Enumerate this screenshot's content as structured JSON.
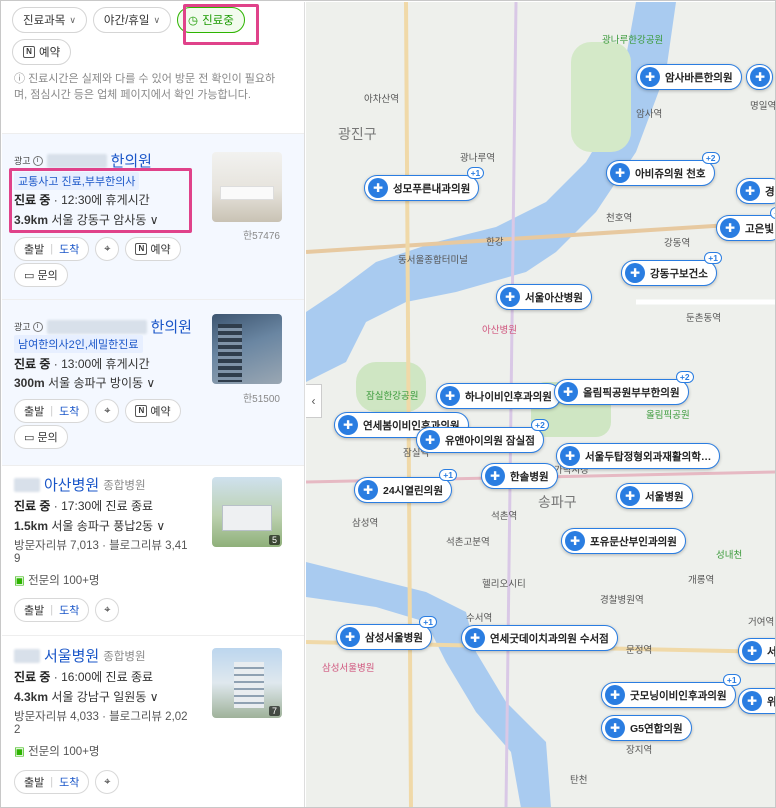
{
  "filters": {
    "subject": "진료과목",
    "night": "야간/휴일",
    "open": "진료중",
    "reserve": "예약"
  },
  "notice": "진료시간은 실제와 다를 수 있어 방문 전 확인이 필요하며, 점심시간 등은 업체 페이지에서 확인 가능합니다.",
  "cards": [
    {
      "ad": "광고",
      "name": "한의원",
      "promo": "교통사고 진료,부부한의사",
      "status_label": "진료 중",
      "status_rest": " · 12:30에 휴게시간",
      "distance": "3.9km",
      "address": "서울 강동구 암사동",
      "thumb_caption": "한57476",
      "btn_depart": "출발",
      "btn_arrive": "도착",
      "btn_reserve": "예약",
      "btn_inquiry": "문의"
    },
    {
      "ad": "광고",
      "name": "한의원",
      "promo": "남여한의사2인,세밀한진료",
      "status_label": "진료 중",
      "status_rest": " · 13:00에 휴게시간",
      "distance": "300m",
      "address": "서울 송파구 방이동",
      "thumb_caption": "한51500",
      "btn_depart": "출발",
      "btn_arrive": "도착",
      "btn_reserve": "예약",
      "btn_inquiry": "문의"
    },
    {
      "name": "아산병원",
      "category": "종합병원",
      "status_label": "진료 중",
      "status_rest": " · 17:30에 진료 종료",
      "distance": "1.5km",
      "address": "서울 송파구 풍납2동",
      "reviews": "방문자리뷰 7,013 · 블로그리뷰 3,41",
      "reviews2": "9",
      "specialists": "전문의 100+명",
      "thumb_count": "5",
      "btn_depart": "출발",
      "btn_arrive": "도착"
    },
    {
      "name": "서울병원",
      "category": "종합병원",
      "status_label": "진료 중",
      "status_rest": " · 16:00에 진료 종료",
      "distance": "4.3km",
      "address": "서울 강남구 일원동",
      "reviews": "방문자리뷰 4,033 · 블로그리뷰 2,02",
      "reviews2": "2",
      "specialists": "전문의 100+명",
      "thumb_count": "7",
      "btn_depart": "출발",
      "btn_arrive": "도착"
    }
  ],
  "map": {
    "labels": {
      "l1": "광진구",
      "l2": "송파구",
      "l3": "아차산역",
      "l4": "광나루역",
      "l5": "천호역",
      "l6": "강동역",
      "l7": "잠실역",
      "l8": "석촌역",
      "l9": "삼성역",
      "l10": "수서역",
      "l11": "한강",
      "l12": "올림픽공원",
      "l13": "가락시장",
      "l14": "둔촌동역",
      "l15": "암사역",
      "l16": "명일역",
      "l17": "개롱역",
      "l18": "경찰병원역",
      "l19": "장지역",
      "l20": "광나루한강공원",
      "l21": "잠실한강공원",
      "l22": "삼성서울병원",
      "l23": "헬리오시티",
      "l24": "석촌고분역",
      "l25": "성내천",
      "l26": "문정역",
      "l27": "거여역",
      "l28": "동서울종합터미널",
      "l29": "아산병원",
      "l30": "탄천"
    },
    "pins": [
      "암사바른한의원",
      "아비쥬의원 천호",
      "성모푸른내과의원",
      "경",
      "고은빛",
      "강동구보건소",
      "서울아산병원",
      "하나이비인후과의원",
      "올림픽공원부부한의원",
      "연세봄이비인후과의원",
      "유앤아이의원 잠실점",
      "서울두탑정형외과재활의학…",
      "24시열린의원",
      "한솔병원",
      "서울병원",
      "포유문산부인과의원",
      "삼성서울병원",
      "연세굿데이치과의원 수서점",
      "굿모닝이비인후과의원",
      "G5연합의원",
      "서",
      "위"
    ],
    "plus": {
      "p1": "+2",
      "p2": "+1",
      "p3": "+1",
      "p4": "+1",
      "p5": "+2",
      "p6": "+2",
      "p7": "+1",
      "p8": "+1",
      "p9": "+1"
    }
  }
}
